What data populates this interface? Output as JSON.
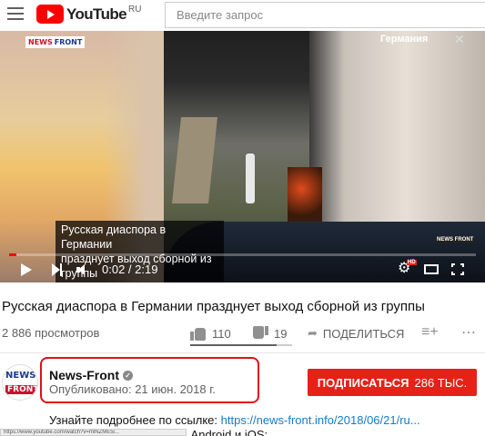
{
  "header": {
    "logo_text": "YouTube",
    "country_code": "RU",
    "search_placeholder": "Введите запрос"
  },
  "player": {
    "watermark_news": "NEWS",
    "watermark_front": "FRONT",
    "country_label": "Германия",
    "caption_line1": "Русская диаспора в Германии",
    "caption_line2": "празднует выход сборной из группы",
    "small_watermark": "NEWS FRONT",
    "time": "0:02 / 2:19",
    "hd_badge": "HD",
    "progress_fraction": 0.015,
    "icons": [
      "close-icon",
      "play-icon",
      "next-icon",
      "volume-icon",
      "gear-icon",
      "theater-icon",
      "fullscreen-icon"
    ]
  },
  "video": {
    "title": "Русская диаспора в Германии празднует выход сборной из группы",
    "views": "2 886 просмотров",
    "likes": "110",
    "dislikes": "19",
    "like_ratio": 0.85,
    "share_label": "ПОДЕЛИТЬСЯ"
  },
  "channel": {
    "avatar_top": "NEWS",
    "avatar_bottom": "FRONT",
    "name": "News-Front",
    "published": "Опубликовано: 21 июн. 2018 г.",
    "subscribe_label": "ПОДПИСАТЬСЯ",
    "subscriber_count": "286 ТЫС."
  },
  "description": {
    "line1_prefix": "Узнайте подробнее по ссылке: ",
    "line1_link": "https://news-front.info/2018/06/21/ru...",
    "line2": "Скачать приложения для Android и iOS:"
  },
  "status_bar": {
    "url": "https://www.youtube.com/watch?v=mlNZME5i..."
  },
  "colors": {
    "brand_red": "#ff0000",
    "subscribe_red": "#e62117",
    "link_blue": "#167ac6",
    "highlight_red": "#e0101a"
  }
}
